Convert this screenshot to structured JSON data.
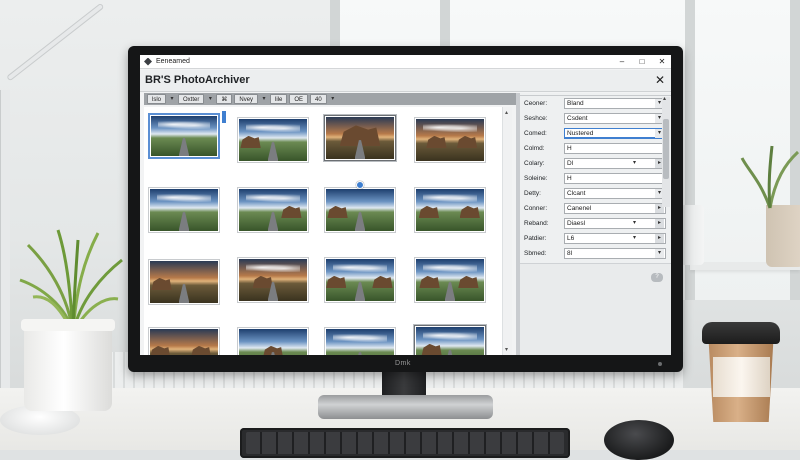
{
  "window": {
    "titlebar_text": "Eeneamed",
    "app_title": "BR'S PhotoArchiver",
    "close_glyph": "✕",
    "min_glyph": "–",
    "max_glyph": "□"
  },
  "toolbar": {
    "items": [
      "lslo",
      "Oxtter",
      "Nvey",
      "lile",
      "OE",
      "40"
    ],
    "dropdown_arrow": "▾",
    "filter_glyph": "⌘"
  },
  "grid": {
    "scroll_up": "▴",
    "scroll_down": "▾"
  },
  "properties": [
    {
      "label": "Ceoner:",
      "value": "Bland",
      "control": "▾"
    },
    {
      "label": "Seshce:",
      "value": "Csdent",
      "control": "▾"
    },
    {
      "label": "Comed:",
      "value": "Nustered",
      "control": "▾",
      "active": true
    },
    {
      "label": "Colmd:",
      "value": "H",
      "control": ""
    },
    {
      "label": "Colary:",
      "value": "Dl",
      "control": "▸",
      "split": "▾"
    },
    {
      "label": "Soleine:",
      "value": "H",
      "control": ""
    },
    {
      "label": "Detty:",
      "value": "Clcant",
      "control": "▾"
    },
    {
      "label": "Conner:",
      "value": "Canenel",
      "control": "▸"
    },
    {
      "label": "Reband:",
      "value": "Diaesl",
      "control": "▸",
      "split": "▾"
    },
    {
      "label": "Patdier:",
      "value": "L6",
      "control": "▸",
      "split": "▾"
    },
    {
      "label": "Sbmed:",
      "value": "8l",
      "control": "▾"
    }
  ],
  "panel": {
    "help_badge": "?"
  },
  "monitor": {
    "brand": "Dmk"
  }
}
